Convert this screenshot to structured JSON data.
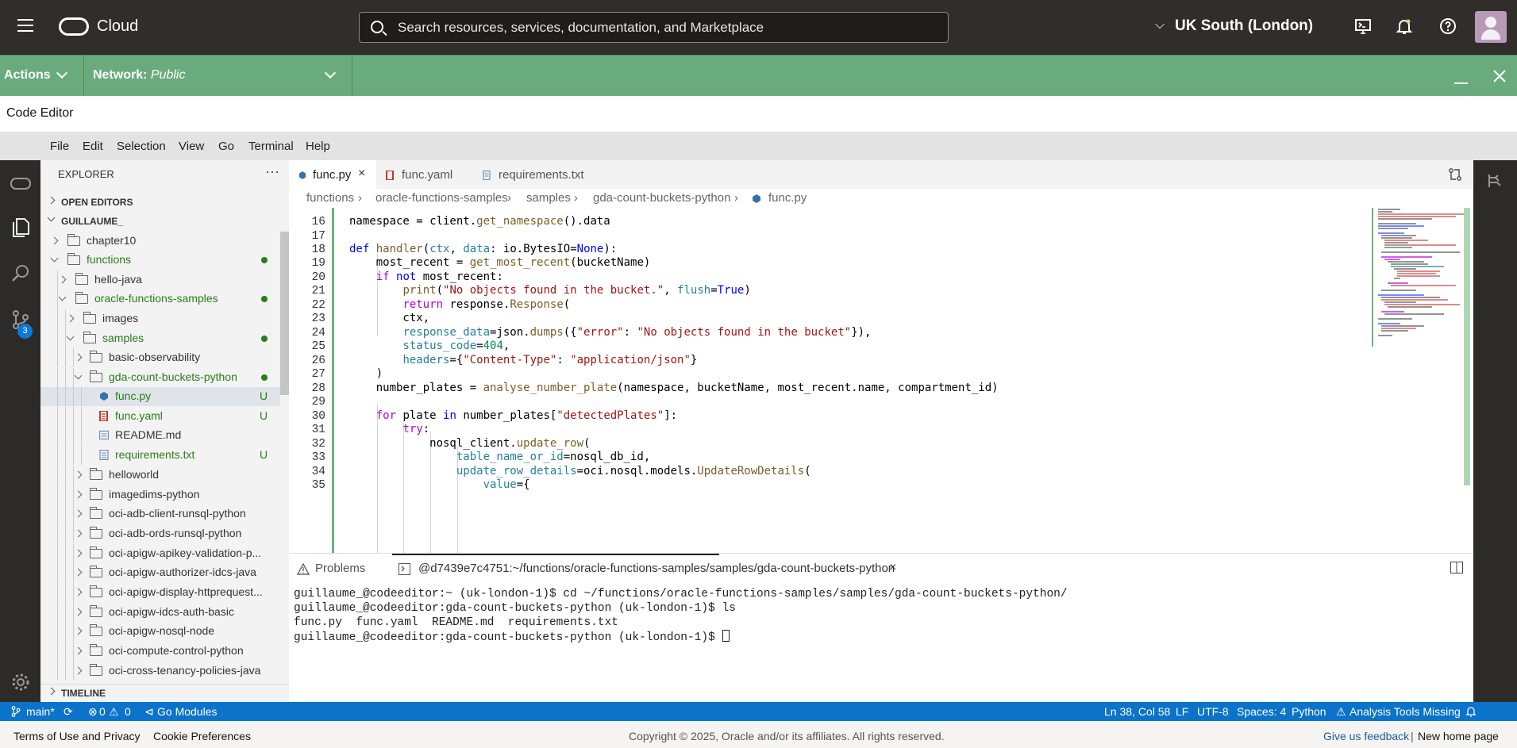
{
  "topbar": {
    "brand": "Cloud",
    "search_placeholder": "Search resources, services, documentation, and Marketplace",
    "region": "UK South (London)"
  },
  "actionbar": {
    "actions_label": "Actions",
    "network_label": "Network:",
    "network_value": "Public"
  },
  "title": "Code Editor",
  "menu": [
    "File",
    "Edit",
    "Selection",
    "View",
    "Go",
    "Terminal",
    "Help"
  ],
  "activity": {
    "scm_badge": "3"
  },
  "explorer": {
    "header": "EXPLORER",
    "more": "···",
    "open_editors": "OPEN EDITORS",
    "workspace": "GUILLAUME_",
    "timeline": "TIMELINE",
    "tree": [
      {
        "label": "chapter10"
      },
      {
        "label": "functions"
      },
      {
        "label": "hello-java"
      },
      {
        "label": "oracle-functions-samples"
      },
      {
        "label": "images"
      },
      {
        "label": "samples"
      },
      {
        "label": "basic-observability"
      },
      {
        "label": "gda-count-buckets-python"
      },
      {
        "label": "func.py",
        "status": "U"
      },
      {
        "label": "func.yaml",
        "status": "U"
      },
      {
        "label": "README.md"
      },
      {
        "label": "requirements.txt",
        "status": "U"
      },
      {
        "label": "helloworld"
      },
      {
        "label": "imagedims-python"
      },
      {
        "label": "oci-adb-client-runsql-python"
      },
      {
        "label": "oci-adb-ords-runsql-python"
      },
      {
        "label": "oci-apigw-apikey-validation-p..."
      },
      {
        "label": "oci-apigw-authorizer-idcs-java"
      },
      {
        "label": "oci-apigw-display-httprequest..."
      },
      {
        "label": "oci-apigw-idcs-auth-basic"
      },
      {
        "label": "oci-apigw-nosql-node"
      },
      {
        "label": "oci-compute-control-python"
      },
      {
        "label": "oci-cross-tenancy-policies-java"
      }
    ]
  },
  "tabs": [
    {
      "label": "func.py",
      "close": "×"
    },
    {
      "label": "func.yaml"
    },
    {
      "label": "requirements.txt"
    }
  ],
  "breadcrumb": [
    "functions",
    "oracle-functions-samples",
    "samples",
    "gda-count-buckets-python",
    "func.py"
  ],
  "breadcrumb_sep": "›",
  "code": {
    "line_numbers": [
      "16",
      "17",
      "18",
      "19",
      "20",
      "21",
      "22",
      "23",
      "24",
      "25",
      "26",
      "27",
      "28",
      "29",
      "30",
      "31",
      "32",
      "33",
      "34",
      "35"
    ]
  },
  "panel": {
    "problems_label": "Problems",
    "terminal_tab": "@d7439e7c4751:~/functions/oracle-functions-samples/samples/gda-count-buckets-python",
    "terminal_close": "×",
    "terminal_lines": [
      "guillaume_@codeeditor:~ (uk-london-1)$ cd ~/functions/oracle-functions-samples/samples/gda-count-buckets-python/",
      "guillaume_@codeeditor:gda-count-buckets-python (uk-london-1)$ ls",
      "func.py  func.yaml  README.md  requirements.txt",
      "guillaume_@codeeditor:gda-count-buckets-python (uk-london-1)$ "
    ]
  },
  "statusbar": {
    "branch": "main*",
    "errors": "0",
    "warnings": "0",
    "go_modules": "Go Modules",
    "position": "Ln 38, Col 58",
    "eol": "LF",
    "encoding": "UTF-8",
    "spaces": "Spaces: 4",
    "language": "Python",
    "analysis": "Analysis Tools Missing"
  },
  "footer": {
    "terms": "Terms of Use and Privacy",
    "cookies": "Cookie Preferences",
    "copyright": "Copyright © 2025, Oracle and/or its affiliates. All rights reserved.",
    "feedback": "Give us feedback",
    "divider": "|",
    "home": "New home page"
  },
  "colors": {
    "topbar": "#312d2a",
    "actionbar": "#6aab7e",
    "statusbar": "#0b73c9",
    "git_added": "#2a7d17"
  }
}
